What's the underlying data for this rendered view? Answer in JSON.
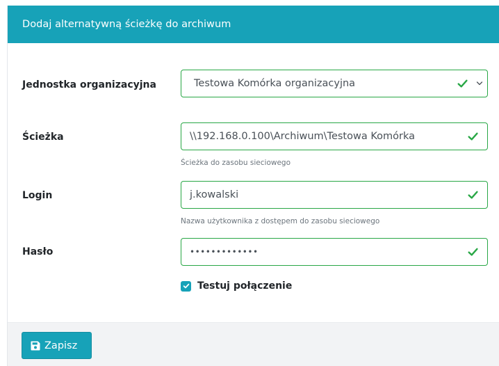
{
  "header": {
    "title": "Dodaj alternatywną ścieżkę do archiwum"
  },
  "form": {
    "unit": {
      "label": "Jednostka organizacyjna",
      "value": "Testowa Komórka organizacyjna",
      "status_icon": "check-icon",
      "dropdown_icon": "chevron-down-icon"
    },
    "path": {
      "label": "Ścieżka",
      "value": "\\\\192.168.0.100\\Archiwum\\Testowa Komórka",
      "help": "Ścieżka do zasobu sieciowego",
      "status_icon": "check-icon"
    },
    "login": {
      "label": "Login",
      "value": "j.kowalski",
      "help": "Nazwa użytkownika z dostępem do zasobu sieciowego",
      "status_icon": "check-icon"
    },
    "password": {
      "label": "Hasło",
      "value": "•••••••••••••",
      "status_icon": "check-icon"
    },
    "test_connection": {
      "label": "Testuj połączenie",
      "checked": true
    }
  },
  "footer": {
    "save_label": "Zapisz",
    "save_icon": "floppy-disk-icon"
  },
  "colors": {
    "header": "#17a2b8",
    "valid": "#28a745",
    "button": "#17a2b8",
    "footer_bg": "#f2f3f5"
  }
}
